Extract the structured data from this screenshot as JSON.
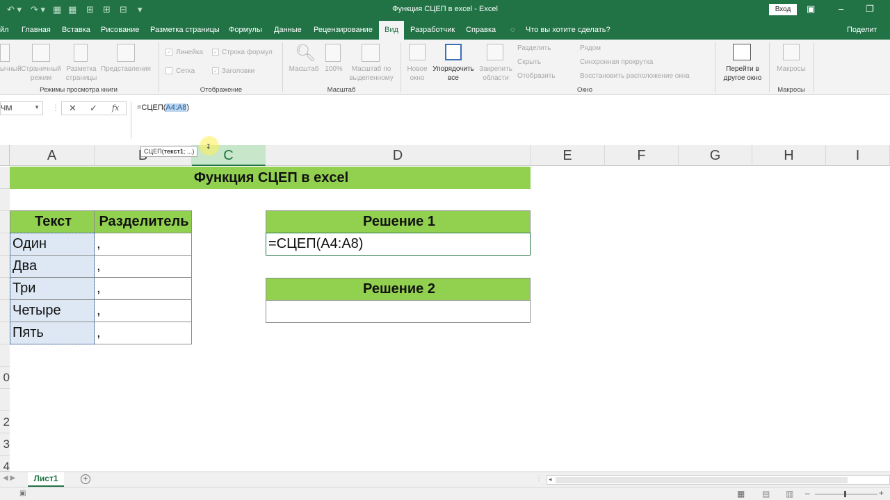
{
  "title_bar": {
    "title": "Функция СЦЕП в excel  -  Excel",
    "login_button": "Вход",
    "minimize": "–",
    "restore": "❐"
  },
  "tabs": [
    {
      "label": "йл"
    },
    {
      "label": "Главная"
    },
    {
      "label": "Вставка"
    },
    {
      "label": "Рисование"
    },
    {
      "label": "Разметка страницы"
    },
    {
      "label": "Формулы"
    },
    {
      "label": "Данные"
    },
    {
      "label": "Рецензирование"
    },
    {
      "label": "Вид"
    },
    {
      "label": "Разработчик"
    },
    {
      "label": "Справка"
    },
    {
      "label": "Что вы хотите сделать?"
    },
    {
      "label": "Поделит"
    }
  ],
  "ribbon": {
    "views": {
      "normal": "ычный",
      "page_layout": "Страничный режим",
      "page_break": "Разметка страницы",
      "custom": "Представления",
      "group_label": "Режимы просмотра книги"
    },
    "show": {
      "ruler": "Линейка",
      "formula_bar": "Строка формул",
      "gridlines": "Сетка",
      "headings": "Заголовки",
      "group_label": "Отображение"
    },
    "zoom": {
      "zoom": "Масштаб",
      "hundred": "100%",
      "to_selection": "Масштаб по выделенному",
      "group_label": "Масштаб"
    },
    "window": {
      "new_window": "Новое окно",
      "arrange_all": "Упорядочить все",
      "freeze": "Закрепить области",
      "split": "Разделить",
      "hide": "Скрыть",
      "unhide": "Отобразить",
      "side_by_side": "Рядом",
      "sync_scroll": "Синхронная прокрутка",
      "reset_position": "Восстановить расположение окна",
      "switch_windows": "Перейти в другое окно",
      "group_label": "Окно"
    },
    "macros": {
      "macros": "Макросы",
      "group_label": "Макросы"
    }
  },
  "formula_bar": {
    "name_box": "ЧМ",
    "cancel": "✕",
    "enter": "✓",
    "fx": "fx",
    "formula_prefix": "=СЦЕП(",
    "formula_range": "A4:A8",
    "formula_suffix": ")"
  },
  "tooltip": {
    "prefix": "СЦЕП(",
    "bold_arg": "текст1",
    "rest": "; ...)"
  },
  "columns": [
    "A",
    "B",
    "C",
    "D",
    "E",
    "F",
    "G",
    "H",
    "I"
  ],
  "row_numbers": [
    "",
    "",
    "",
    "",
    "",
    "",
    "",
    "",
    "",
    "0",
    "",
    "2",
    "3",
    "4"
  ],
  "sheet": {
    "banner": "Функция СЦЕП в excel",
    "table_headers": {
      "text": "Текст",
      "separator": "Разделитель"
    },
    "rows": [
      {
        "text": "Один",
        "sep": ","
      },
      {
        "text": "Два",
        "sep": ","
      },
      {
        "text": "Три",
        "sep": ","
      },
      {
        "text": "Четыре",
        "sep": ","
      },
      {
        "text": "Пять",
        "sep": ","
      }
    ],
    "solution1_header": "Решение 1",
    "solution1_value": "=СЦЕП(A4:A8)",
    "solution2_header": "Решение 2",
    "solution2_value": ""
  },
  "sheet_tabs": {
    "active": "Лист1",
    "add": "+"
  },
  "colors": {
    "accent": "#217346",
    "banner": "#92d050"
  }
}
